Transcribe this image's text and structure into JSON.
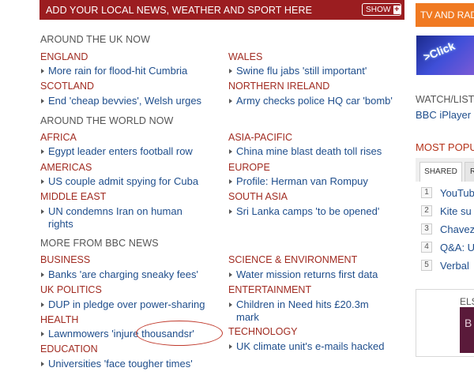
{
  "banner": {
    "text": "ADD YOUR LOCAL NEWS, WEATHER AND SPORT HERE",
    "show_label": "SHOW",
    "show_icon": "+"
  },
  "sidebar": {
    "tv_banner": "TV AND RAD",
    "promo_image_text": ">Click",
    "watch_label": "WATCH/LIST",
    "iplayer": "BBC iPlayer",
    "most_popular": "MOST POPU",
    "tab_shared": "SHARED",
    "tab_other": "R",
    "popular": [
      {
        "num": "1",
        "text": "YouTub"
      },
      {
        "num": "2",
        "text": "Kite su"
      },
      {
        "num": "3",
        "text": "Chavez"
      },
      {
        "num": "4",
        "text": "Q&A: U"
      },
      {
        "num": "5",
        "text": "Verbal"
      }
    ],
    "promo_label": "ELS",
    "promo_img_text": "B"
  },
  "uk": {
    "heading": "AROUND THE UK NOW",
    "england": {
      "cat": "ENGLAND",
      "story": "More rain for flood-hit Cumbria"
    },
    "wales": {
      "cat": "WALES",
      "story": "Swine flu jabs 'still important'"
    },
    "scotland": {
      "cat": "SCOTLAND",
      "story": "End 'cheap bevvies', Welsh urges"
    },
    "ni": {
      "cat": "NORTHERN IRELAND",
      "story": "Army checks police HQ car 'bomb'"
    }
  },
  "world": {
    "heading": "AROUND THE WORLD NOW",
    "africa": {
      "cat": "AFRICA",
      "story": "Egypt leader enters football row"
    },
    "asia": {
      "cat": "ASIA-PACIFIC",
      "story": "China mine blast death toll rises"
    },
    "americas": {
      "cat": "AMERICAS",
      "story": "US couple admit spying for Cuba"
    },
    "europe": {
      "cat": "EUROPE",
      "story": "Profile: Herman van Rompuy"
    },
    "middle_east": {
      "cat": "MIDDLE EAST",
      "story": "UN condemns Iran on human rights"
    },
    "south_asia": {
      "cat": "SOUTH ASIA",
      "story": "Sri Lanka camps 'to be opened'"
    }
  },
  "more": {
    "heading": "MORE FROM BBC NEWS",
    "business": {
      "cat": "BUSINESS",
      "story": "Banks 'are charging sneaky fees'"
    },
    "science": {
      "cat": "SCIENCE & ENVIRONMENT",
      "story": "Water mission returns first data"
    },
    "uk_politics": {
      "cat": "UK POLITICS",
      "story": "DUP in pledge over power-sharing"
    },
    "entertainment": {
      "cat": "ENTERTAINMENT",
      "story": "Children in Need hits £20.3m mark"
    },
    "health": {
      "cat": "HEALTH",
      "story": "Lawnmowers 'injure thousandsr'"
    },
    "technology": {
      "cat": "TECHNOLOGY",
      "story": "UK climate unit's e-mails hacked"
    },
    "education": {
      "cat": "EDUCATION",
      "story": "Universities 'face tougher times'"
    }
  },
  "colors": {
    "banner_bg": "#9b1d20",
    "category_red": "#a12c22",
    "link_blue": "#1f4e8c",
    "tv_orange": "#f07a22"
  }
}
